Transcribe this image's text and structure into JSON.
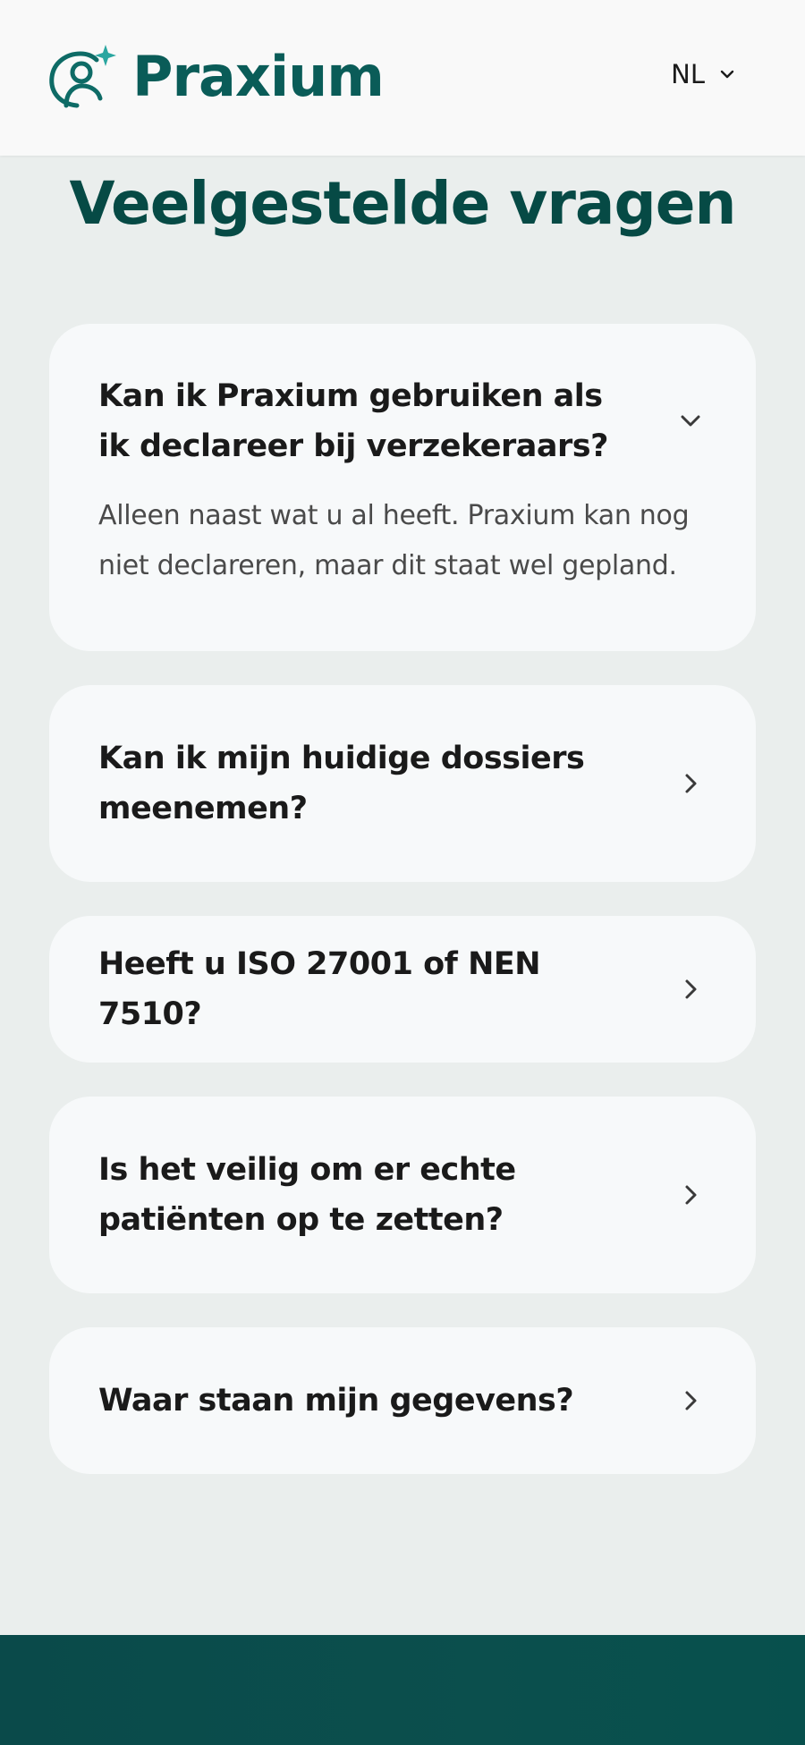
{
  "header": {
    "brand": "Praxium",
    "language": "NL",
    "logo_icon": "person-sparkle-icon",
    "language_icon": "chevron-down-icon"
  },
  "colors": {
    "brand": "#0a5c58",
    "title": "#064a45",
    "page_bg": "#eaeeed",
    "card_bg": "#f7f9fa",
    "footer": "#0a4a4a"
  },
  "page": {
    "title": "Veelgestelde vragen"
  },
  "faq": [
    {
      "question": "Kan ik Praxium gebruiken als ik declareer bij verzekeraars?",
      "answer": "Alleen naast wat u al heeft. Praxium kan nog niet declareren, maar dit staat wel gepland.",
      "expanded": true,
      "icon": "chevron-down-icon"
    },
    {
      "question": "Kan ik mijn huidige dossiers meenemen?",
      "expanded": false,
      "icon": "chevron-right-icon"
    },
    {
      "question": "Heeft u ISO 27001 of NEN 7510?",
      "expanded": false,
      "icon": "chevron-right-icon"
    },
    {
      "question": "Is het veilig om er echte patiënten op te zetten?",
      "expanded": false,
      "icon": "chevron-right-icon"
    },
    {
      "question": "Waar staan mijn gegevens?",
      "expanded": false,
      "icon": "chevron-right-icon"
    }
  ]
}
